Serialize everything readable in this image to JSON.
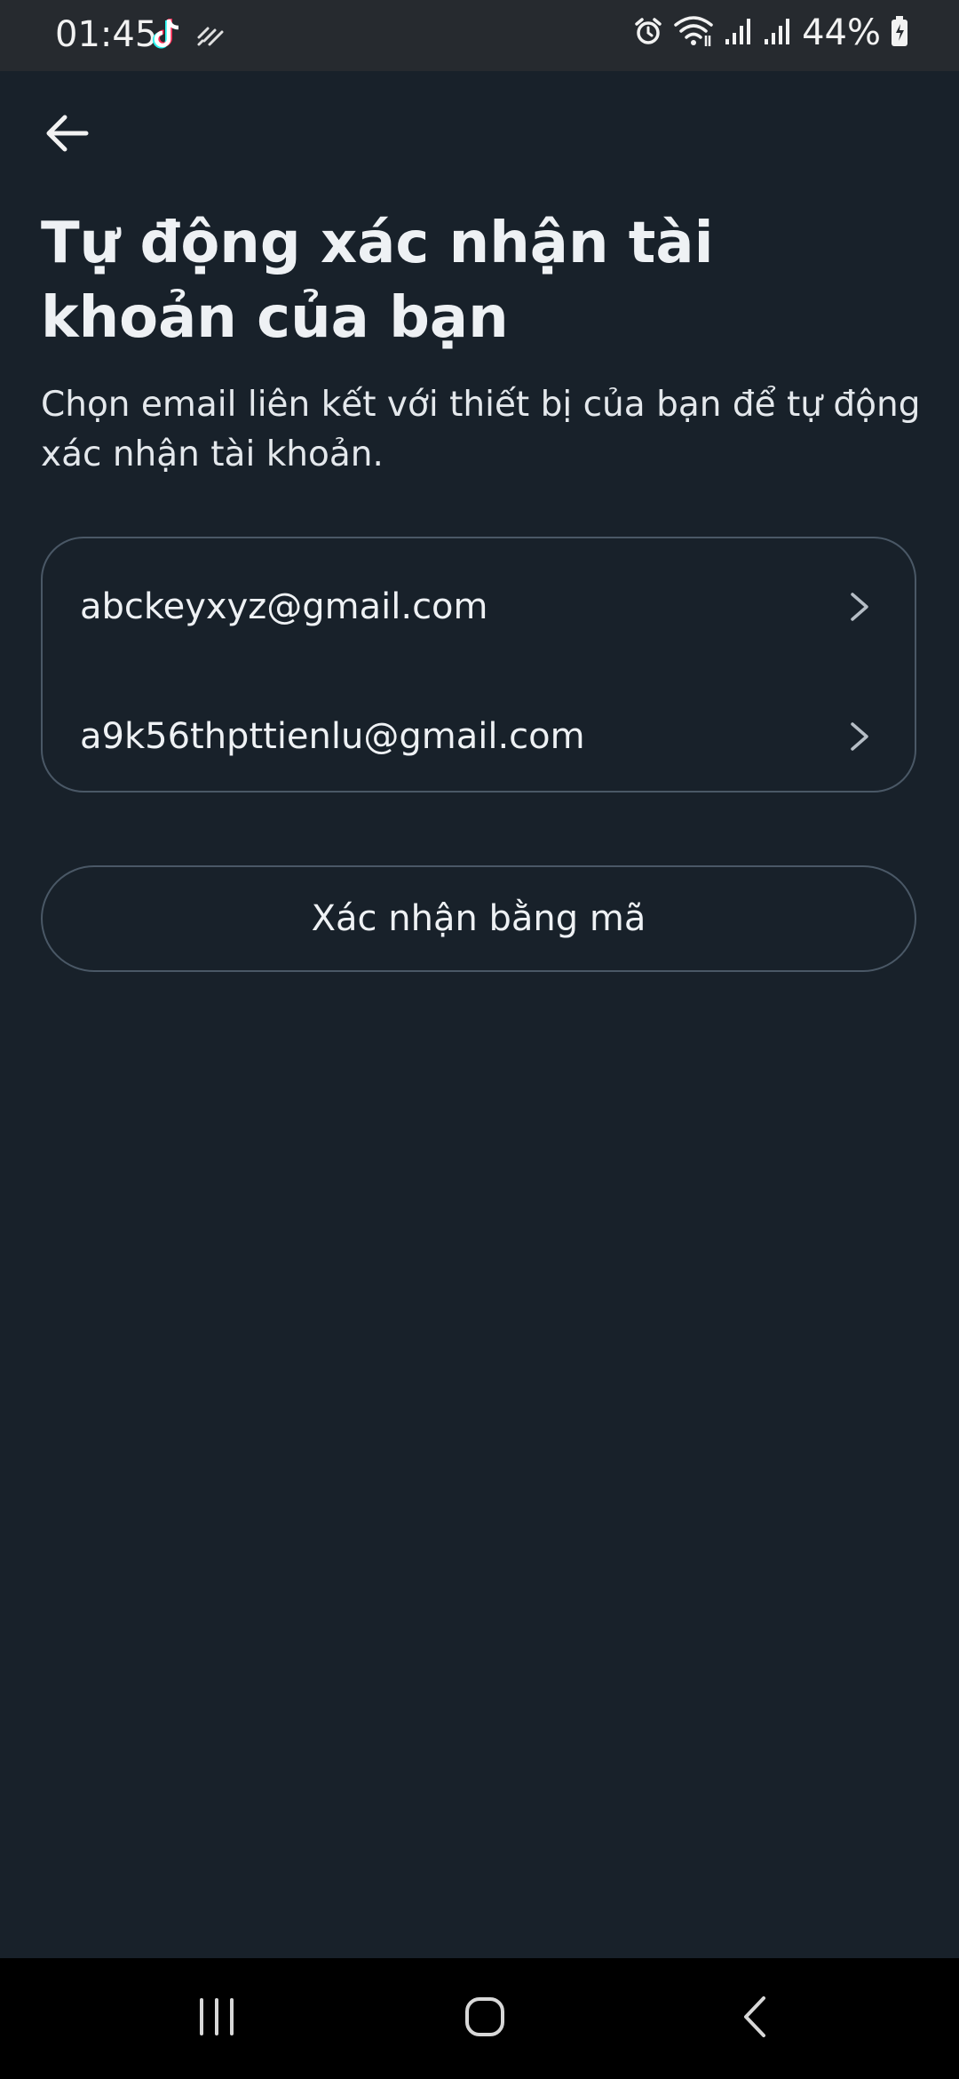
{
  "status_bar": {
    "time": "01:45",
    "battery": "44%",
    "icons": [
      "tiktok-icon",
      "sync-icon",
      "alarm-icon",
      "wifi-icon",
      "signal-icon",
      "signal-icon",
      "battery-icon"
    ]
  },
  "header": {
    "back_icon": "arrow-left-icon",
    "title": "Tự động xác nhận tài khoản của bạn",
    "subtitle": "Chọn email liên kết với thiết bị của bạn để tự động xác nhận tài khoản."
  },
  "emails": [
    {
      "address": "abckeyxyz@gmail.com"
    },
    {
      "address": "a9k56thpttienlu@gmail.com"
    }
  ],
  "code_button": {
    "label": "Xác nhận bằng mã"
  },
  "nav_bar": {
    "items": [
      "recents-icon",
      "home-icon",
      "back-icon"
    ]
  },
  "colors": {
    "background": "#18212a",
    "border": "#4a5866",
    "text": "#eef1f4"
  }
}
